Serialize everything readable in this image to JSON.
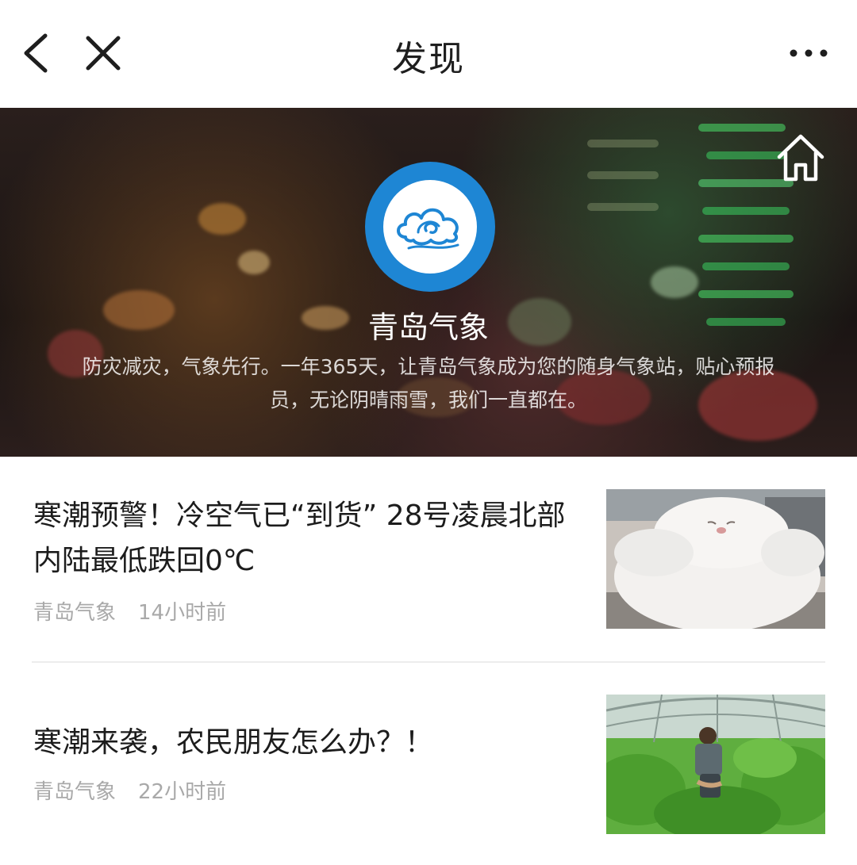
{
  "header": {
    "title": "发现",
    "back_icon": "chevron-left-icon",
    "close_icon": "close-icon",
    "more_icon": "more-horizontal-icon"
  },
  "profile": {
    "name": "青岛气象",
    "description": "防灾减灾，气象先行。一年365天，让青岛气象成为您的随身气象站，贴心预报员，无论阴晴雨雪，我们一直都在。",
    "home_icon": "home-icon",
    "logo_icon": "cloud-logo-icon",
    "logo_color": "#1e86d4"
  },
  "articles": [
    {
      "title": "寒潮预警！冷空气已“到货” 28号凌晨北部内陆最低跌回0℃",
      "source": "青岛气象",
      "time": "14小时前",
      "thumbnail": "fluffy-white-cat-image"
    },
    {
      "title": "寒潮来袭，农民朋友怎么办？！",
      "source": "青岛气象",
      "time": "22小时前",
      "thumbnail": "greenhouse-farmer-image"
    }
  ]
}
